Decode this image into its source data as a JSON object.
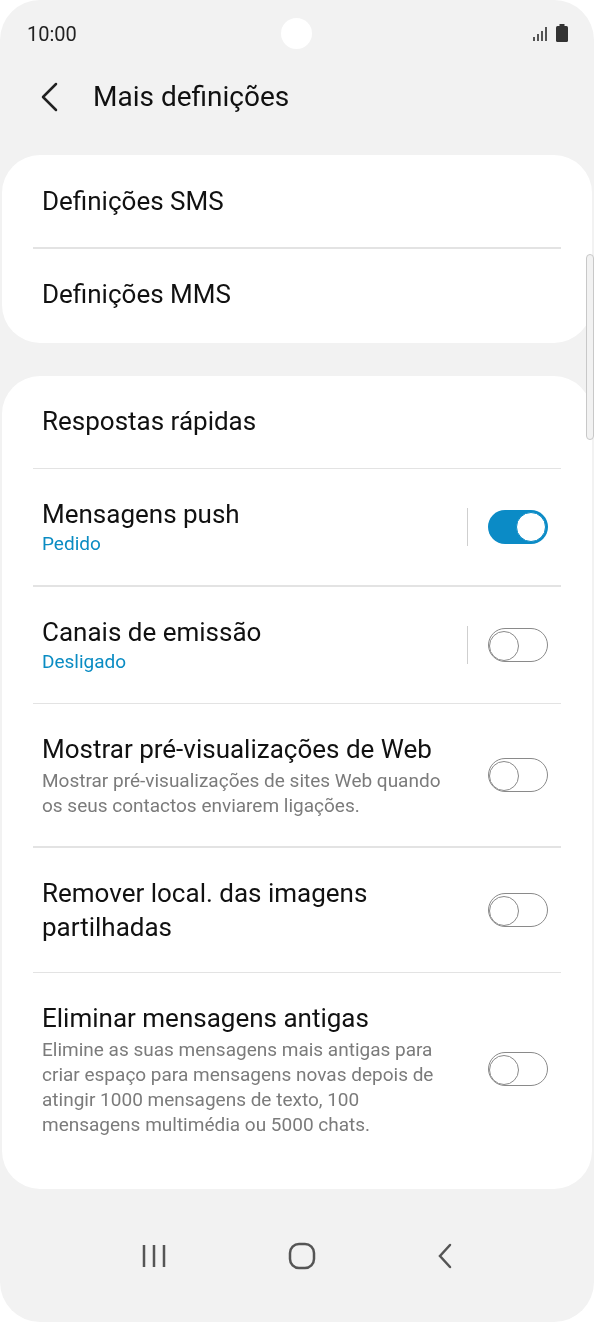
{
  "status_bar": {
    "time": "10:00"
  },
  "header": {
    "title": "Mais definições"
  },
  "groups": [
    {
      "items": [
        {
          "kind": "link",
          "title": "Definições SMS"
        },
        {
          "kind": "link",
          "title": "Definições MMS"
        }
      ]
    },
    {
      "items": [
        {
          "kind": "link",
          "title": "Respostas rápidas"
        },
        {
          "kind": "switch",
          "title": "Mensagens push",
          "status": "Pedido",
          "on": true
        },
        {
          "kind": "switch",
          "title": "Canais de emissão",
          "status": "Desligado",
          "on": false
        },
        {
          "kind": "switch",
          "title": "Mostrar pré-visualizações de Web",
          "description": "Mostrar pré-visualizações de sites Web quando os seus contactos enviarem ligações.",
          "on": false
        },
        {
          "kind": "switch",
          "title": "Remover local. das imagens partilhadas",
          "on": false
        },
        {
          "kind": "switch",
          "title": "Eliminar mensagens antigas",
          "description": "Elimine as suas mensagens mais antigas para criar espaço para mensagens novas depois de atingir 1000 mensagens de texto, 100 mensagens multimédia ou 5000 chats.",
          "on": false
        }
      ]
    }
  ]
}
